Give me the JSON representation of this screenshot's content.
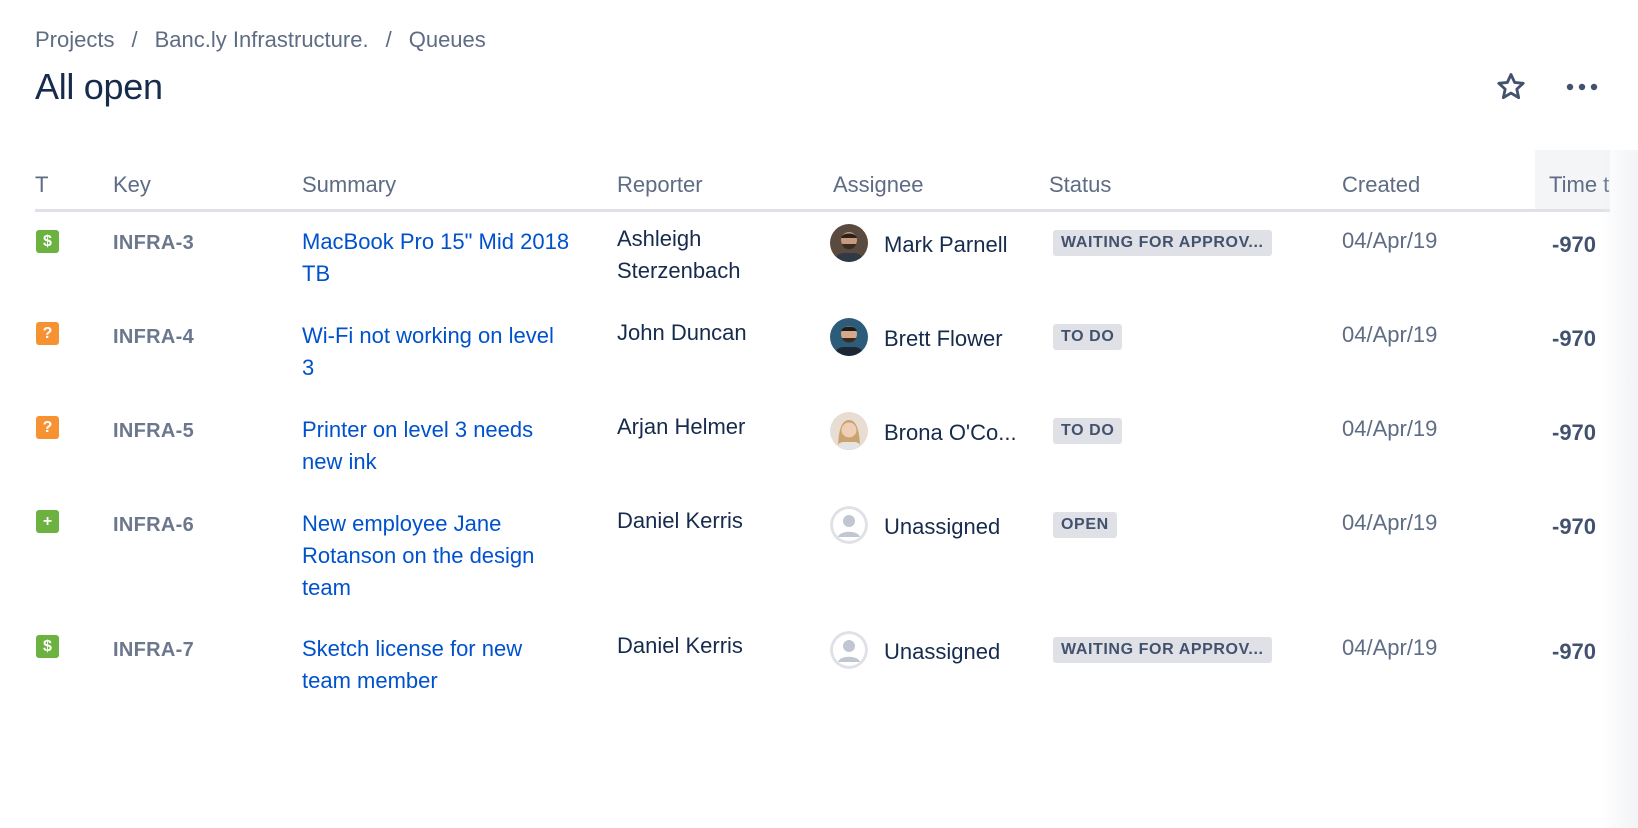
{
  "breadcrumbs": [
    "Projects",
    "Banc.ly Infrastructure.",
    "Queues"
  ],
  "breadcrumb_separator": "/",
  "page_title": "All open",
  "columns": {
    "type": "T",
    "key": "Key",
    "summary": "Summary",
    "reporter": "Reporter",
    "assignee": "Assignee",
    "status": "Status",
    "created": "Created",
    "time": "Time t"
  },
  "rows": [
    {
      "type_icon": "dollar-icon",
      "type_color": "#6bb240",
      "key": "INFRA-3",
      "summary": "MacBook Pro 15\" Mid 2018 TB",
      "reporter": "Ashleigh Sterzenbach",
      "assignee": "Mark Parnell",
      "avatar": "photo",
      "status": "WAITING FOR APPROV...",
      "created": "04/Apr/19",
      "time": "-970"
    },
    {
      "type_icon": "question-icon",
      "type_color": "#f79233",
      "key": "INFRA-4",
      "summary": "Wi-Fi not working on level 3",
      "reporter": "John Duncan",
      "assignee": "Brett Flower",
      "avatar": "photo",
      "status": "TO DO",
      "created": "04/Apr/19",
      "time": "-970"
    },
    {
      "type_icon": "question-icon",
      "type_color": "#f79233",
      "key": "INFRA-5",
      "summary": "Printer on level 3 needs new ink",
      "reporter": "Arjan Helmer",
      "assignee": "Brona O'Co...",
      "avatar": "photo",
      "status": "TO DO",
      "created": "04/Apr/19",
      "time": "-970"
    },
    {
      "type_icon": "plus-icon",
      "type_color": "#6bb240",
      "key": "INFRA-6",
      "summary": "New employee Jane Rotanson on the design team",
      "reporter": "Daniel Kerris",
      "assignee": "Unassigned",
      "avatar": "placeholder",
      "status": "OPEN",
      "created": "04/Apr/19",
      "time": "-970"
    },
    {
      "type_icon": "dollar-icon",
      "type_color": "#6bb240",
      "key": "INFRA-7",
      "summary": "Sketch license for new team member",
      "reporter": "Daniel Kerris",
      "assignee": "Unassigned",
      "avatar": "placeholder",
      "status": "WAITING FOR APPROV...",
      "created": "04/Apr/19",
      "time": "-970"
    }
  ],
  "icons": {
    "star": "star-outline-icon",
    "more": "more-horizontal-icon"
  },
  "colors": {
    "link": "#0052cc",
    "text": "#172b4d",
    "muted": "#5e6c84",
    "lozenge_bg": "#dfe1e6"
  }
}
